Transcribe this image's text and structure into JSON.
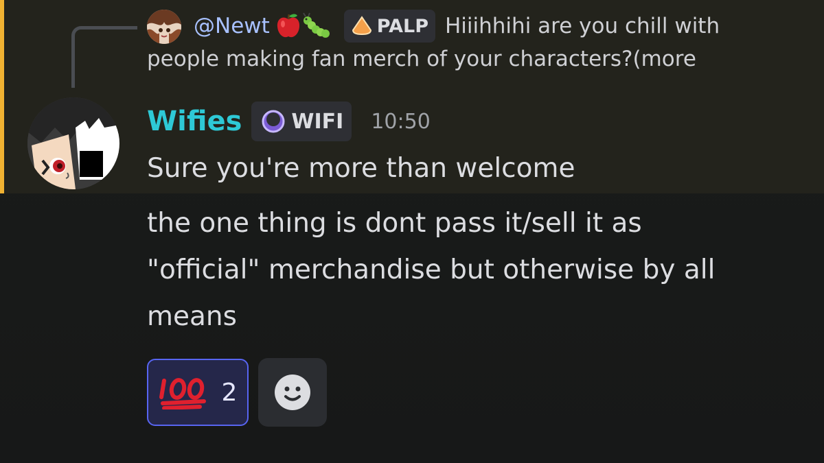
{
  "colors": {
    "mention_bar": "#f0b232",
    "mention_bg": "#23231c",
    "username": "#2ec9d6",
    "reply_author": "#a8c1ff",
    "reaction_border": "#5865f2"
  },
  "reply": {
    "author": "@Newt",
    "emojis": [
      "apple",
      "caterpillar"
    ],
    "tag": "PALP",
    "tag_icon": "orange-dome-icon",
    "text_line1": "Hiiihhihi are you chill with",
    "text_line2": "people making fan merch of your characters?(more"
  },
  "message": {
    "username": "Wifies",
    "tag": "WIFI",
    "tag_icon": "purple-ring-icon",
    "timestamp": "10:50",
    "line1": "Sure you're more than welcome",
    "body_lines": [
      "the one thing is dont pass it/sell it as",
      "\"official\" merchandise but otherwise by all",
      "means"
    ]
  },
  "reactions": [
    {
      "emoji": "100",
      "count": "2",
      "active": true
    }
  ],
  "add_reaction_icon": "smiley-face-icon"
}
